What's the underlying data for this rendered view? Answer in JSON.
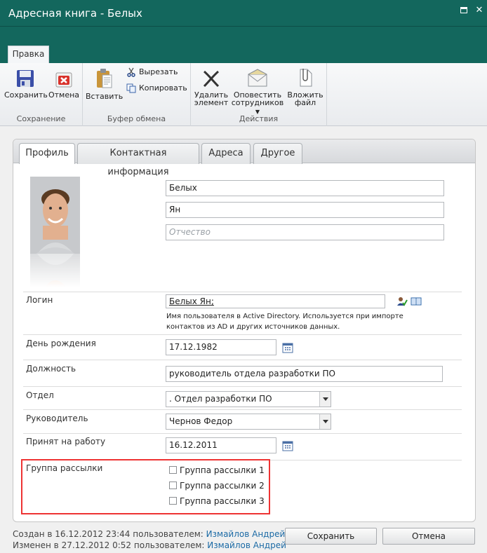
{
  "window": {
    "title": "Адресная книга - Белых"
  },
  "ribbon": {
    "tab_label": "Правка",
    "groups": {
      "save": {
        "label": "Сохранение",
        "save_label": "Сохранить",
        "cancel_label": "Отмена"
      },
      "clipboard": {
        "label": "Буфер обмена",
        "paste_label": "Вставить",
        "cut_label": "Вырезать",
        "copy_label": "Копировать"
      },
      "actions": {
        "label": "Действия",
        "delete_line1": "Удалить",
        "delete_line2": "элемент",
        "notify_line1": "Оповестить",
        "notify_line2": "сотрудников",
        "attach_line1": "Вложить",
        "attach_line2": "файл"
      }
    }
  },
  "tabs": [
    "Профиль",
    "Контактная информация",
    "Адреса",
    "Другое"
  ],
  "name_fields": {
    "last_name": "Белых",
    "first_name": "Ян",
    "middle_name_placeholder": "Отчество"
  },
  "login": {
    "label": "Логин",
    "value": "Белых Ян;",
    "help_line1": "Имя пользователя в Active Directory. Используется при импорте",
    "help_line2": "контактов из AD и других источников данных."
  },
  "birthday": {
    "label": "День рождения",
    "value": "17.12.1982"
  },
  "position": {
    "label": "Должность",
    "value": "руководитель отдела разработки ПО"
  },
  "department": {
    "label": "Отдел",
    "value": ".  Отдел разработки ПО"
  },
  "manager": {
    "label": "Руководитель",
    "value": "Чернов Федор"
  },
  "hired": {
    "label": "Принят на работу",
    "value": "16.12.2011"
  },
  "mailing": {
    "label": "Группа рассылки",
    "groups": [
      "Группа рассылки 1",
      "Группа рассылки 2",
      "Группа рассылки 3"
    ]
  },
  "footer": {
    "created_prefix": "Создан в 16.12.2012 23:44 пользователем:",
    "created_user": "Измайлов Андрей",
    "modified_prefix": "Изменен в 27.12.2012 0:52 пользователем:",
    "modified_user": "Измайлов Андрей",
    "save_label": "Сохранить",
    "cancel_label": "Отмена"
  },
  "colors": {
    "titlebar": "#13675d",
    "highlight_border": "#ee3333",
    "link": "#1b6aa5"
  }
}
